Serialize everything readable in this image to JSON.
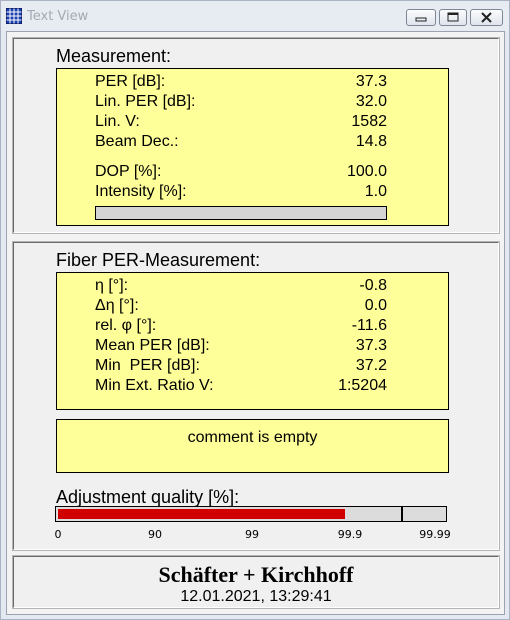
{
  "window": {
    "title": "Text View"
  },
  "measurement": {
    "title": "Measurement:",
    "rows": [
      {
        "label": "PER [dB]:",
        "value": "37.3"
      },
      {
        "label": "Lin. PER [dB]:",
        "value": "32.0"
      },
      {
        "label": "Lin. V:",
        "value": "1582"
      },
      {
        "label": "Beam Dec.:",
        "value": "14.8"
      },
      {
        "label": "DOP [%]:",
        "value": "100.0"
      },
      {
        "label": "Intensity [%]:",
        "value": "1.0"
      }
    ],
    "intensity_fraction": 0.0
  },
  "fiber": {
    "title": "Fiber PER-Measurement:",
    "rows": [
      {
        "label": "η [°]:",
        "value": "-0.8"
      },
      {
        "label": "Δη [°]:",
        "value": "0.0"
      },
      {
        "label": "rel. φ [°]:",
        "value": "-11.6"
      },
      {
        "label": "Mean PER [dB]:",
        "value": "37.3"
      },
      {
        "label": "Min  PER [dB]:",
        "value": "37.2"
      },
      {
        "label": "Min Ext. Ratio V:",
        "value": "1:5204"
      }
    ],
    "comment": "comment is empty",
    "quality": {
      "title": "Adjustment quality [%]:",
      "ticks": [
        "0",
        "90",
        "99",
        "99.9",
        "99.99"
      ],
      "level_fraction": 0.74,
      "marker_fraction": 0.89,
      "fill_color": "#d00000"
    }
  },
  "footer": {
    "brand": "Schäfter + Kirchhoff",
    "timestamp": "12.01.2021, 13:29:41"
  },
  "colors": {
    "panel_yellow": "#ffff99",
    "bar_red": "#c00000"
  }
}
